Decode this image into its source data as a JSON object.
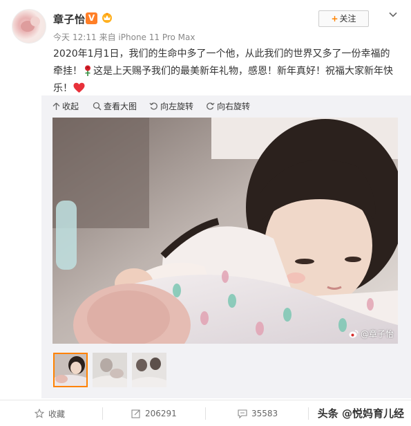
{
  "author": {
    "name": "章子怡",
    "verified_badge": "V",
    "meta_day": "今天",
    "meta_time": "12:11",
    "meta_source": "来自 iPhone 11 Pro Max"
  },
  "follow": {
    "plus": "+",
    "label": "关注"
  },
  "post": {
    "line1_a": "2020年1月1日，我们的生命中多了一个他，从此我们的世界又多了一份幸福的牵挂！",
    "line1_b": "这是上天赐予我们的最美新年礼物，感恩！新年真好！祝福大家新年快乐！"
  },
  "media_toolbar": {
    "collapse": "收起",
    "view_large": "查看大图",
    "rotate_left": "向左旋转",
    "rotate_right": "向右旋转"
  },
  "photo": {
    "watermark": "@章子怡"
  },
  "actions": {
    "favorite": "收藏",
    "repost_count": "206291",
    "comment_count": "35583"
  },
  "footer_watermark": "头条 @悦妈育儿经",
  "colors": {
    "accent": "#ff8200",
    "badge": "#ff7f27",
    "heart": "#e8313a"
  }
}
